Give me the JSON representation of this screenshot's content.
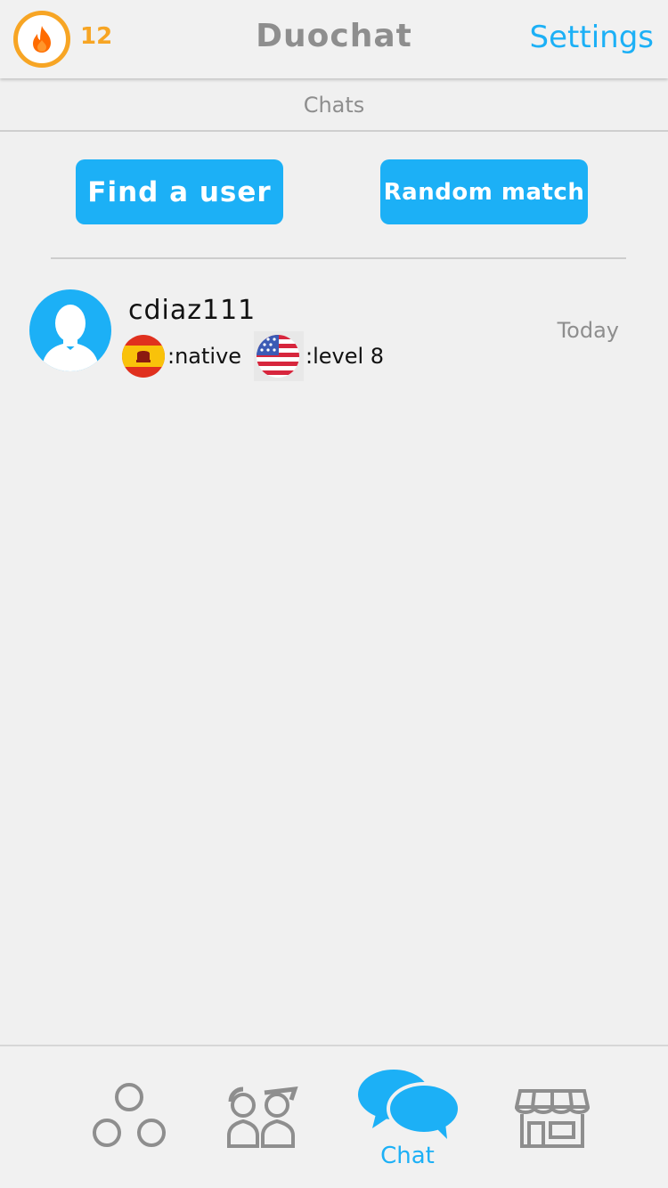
{
  "header": {
    "streak_count": "12",
    "title": "Duochat",
    "settings_label": "Settings"
  },
  "section": {
    "title": "Chats"
  },
  "actions": {
    "find_user_label": "Find a user",
    "random_match_label": "Random match"
  },
  "chats": [
    {
      "username": "cdiaz111",
      "time": "Today",
      "languages": [
        {
          "flag": "spain-flag-icon",
          "text": ":native"
        },
        {
          "flag": "usa-flag-icon",
          "text": ":level 8"
        }
      ]
    }
  ],
  "bottom_nav": {
    "items": [
      {
        "icon": "learn-circles-icon",
        "label": "",
        "active": false
      },
      {
        "icon": "friends-icon",
        "label": "",
        "active": false
      },
      {
        "icon": "chat-bubbles-icon",
        "label": "Chat",
        "active": true
      },
      {
        "icon": "shop-icon",
        "label": "",
        "active": false
      }
    ]
  },
  "colors": {
    "accent": "#1cb0f6",
    "streak": "#f7a524",
    "flame": "#ff6b00",
    "muted_text": "#8e8e8e",
    "background": "#f0f0f0",
    "inactive_icon": "#8e8e8e"
  }
}
